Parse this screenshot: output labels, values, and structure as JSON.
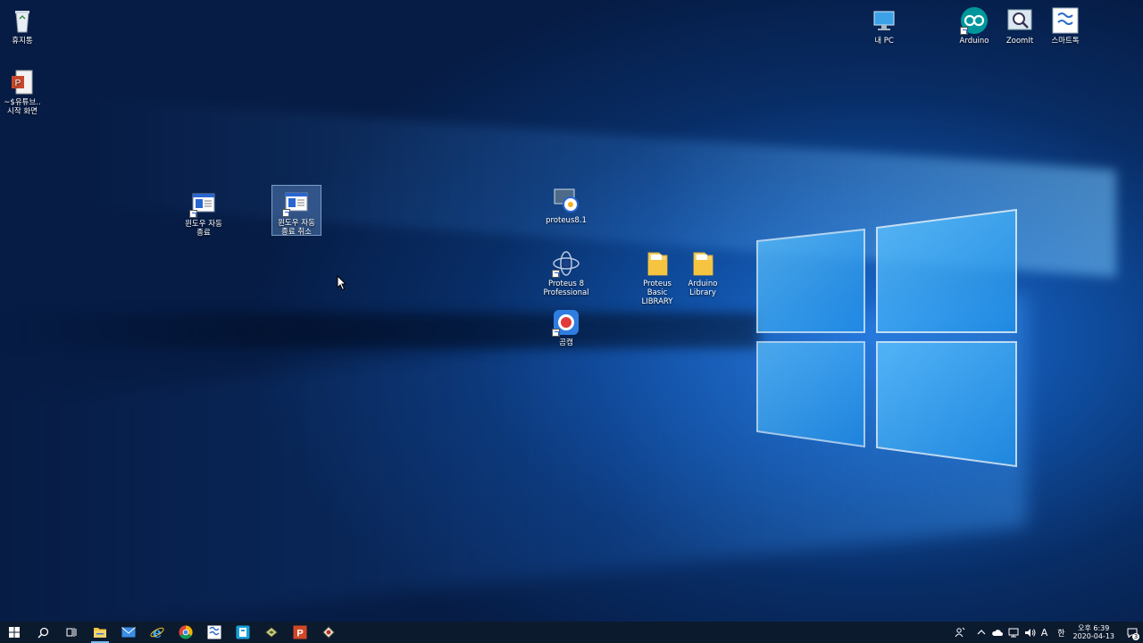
{
  "desktop": {
    "icons": [
      {
        "id": "recycle",
        "label": "휴지통"
      },
      {
        "id": "ppt",
        "label": "~$유튜브..\n시작 화면"
      },
      {
        "id": "mypc",
        "label": "내 PC"
      },
      {
        "id": "arduino",
        "label": "Arduino"
      },
      {
        "id": "zoomit",
        "label": "ZoomIt"
      },
      {
        "id": "smartdoc",
        "label": "스마트톡"
      },
      {
        "id": "autoshutdown",
        "label": "윈도우 자동\n종료"
      },
      {
        "id": "autoshutdown_cancel",
        "label": "윈도우 자동\n종료 취소"
      },
      {
        "id": "proteus81",
        "label": "proteus8.1"
      },
      {
        "id": "proteus8",
        "label": "Proteus 8\nProfessional"
      },
      {
        "id": "proteus_lib",
        "label": "Proteus Basic\nLIBRARY"
      },
      {
        "id": "arduino_lib",
        "label": "Arduino\nLibrary"
      },
      {
        "id": "gomcam",
        "label": "곰캠"
      }
    ]
  },
  "taskbar": {
    "apps": [
      {
        "icon": "start-icon"
      },
      {
        "icon": "search-icon"
      },
      {
        "icon": "task-view-icon"
      },
      {
        "icon": "file-explorer-icon"
      },
      {
        "icon": "mail-icon"
      },
      {
        "icon": "internet-explorer-icon"
      },
      {
        "icon": "chrome-icon"
      },
      {
        "icon": "app-icon"
      },
      {
        "icon": "app-icon-2"
      },
      {
        "icon": "proteus-icon"
      },
      {
        "icon": "powerpoint-icon"
      },
      {
        "icon": "proteus-isis-icon"
      }
    ],
    "tray": {
      "ime_mode": "A",
      "ime_lang": "한",
      "time": "오후 6:39",
      "date": "2020-04-13",
      "notification_count": "3"
    }
  }
}
